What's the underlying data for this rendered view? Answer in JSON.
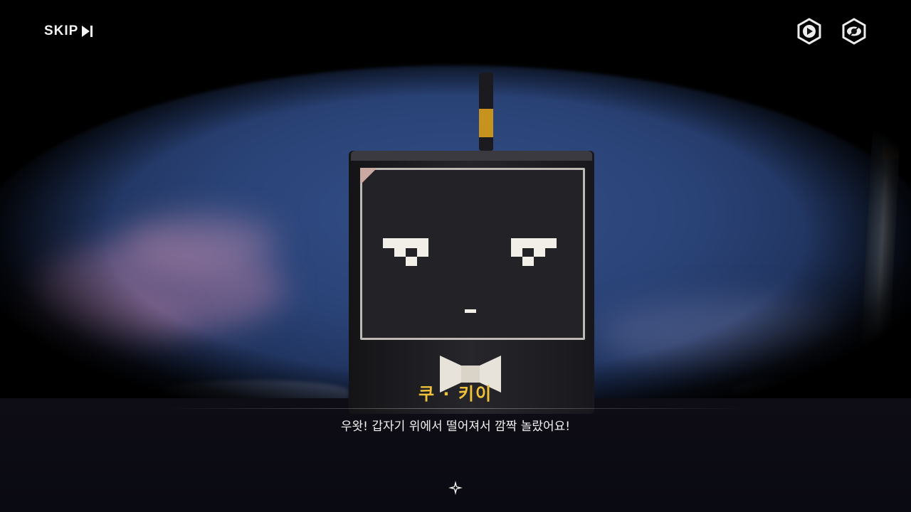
{
  "hud": {
    "skip_label": "SKIP",
    "auto_play_icon": "play-hexagon-icon",
    "hide_ui_icon": "eye-hexagon-icon"
  },
  "dialogue": {
    "speaker": "쿠 · 키이",
    "text": "우왓! 갑자기 위에서 떨어져서 깜짝 놀랐어요!"
  },
  "colors": {
    "speaker_name": "#f0c23a",
    "dialogue_text": "#f2f2f2",
    "antenna_accent": "#c6931f"
  }
}
